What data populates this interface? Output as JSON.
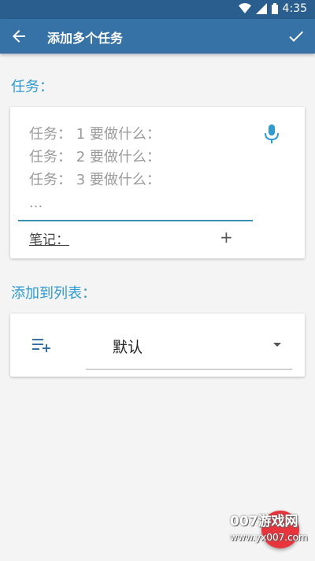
{
  "status": {
    "time": "4:35"
  },
  "appbar": {
    "title": "添加多个任务"
  },
  "tasks_section": {
    "label": "任务：",
    "lines": [
      "任务： 1  要做什么：",
      "任务： 2  要做什么：",
      "任务： 3  要做什么：",
      "..."
    ],
    "notes_label": "笔记：",
    "plus": "+"
  },
  "list_section": {
    "label": "添加到列表：",
    "value": "默认"
  },
  "watermark": {
    "line1": "007游戏网",
    "line2": "www.yx007.com"
  },
  "colors": {
    "appbar": "#3672a6",
    "accent": "#2f9bd1",
    "fab": "#e8353d"
  }
}
